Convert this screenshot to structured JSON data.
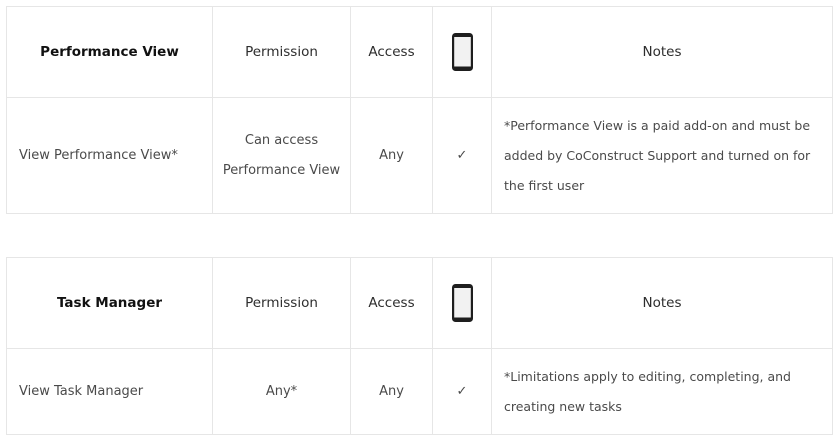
{
  "tables": [
    {
      "header": {
        "feature": "Performance View",
        "permission": "Permission",
        "access": "Access",
        "mobile_icon": "smartphone-icon",
        "notes": "Notes"
      },
      "row": {
        "feature": "View Performance View*",
        "permission_lines": [
          "Can access",
          "Performance View"
        ],
        "access": "Any",
        "mobile": "✓",
        "notes_lines": [
          "*Performance View is a paid add-on and must be",
          "added by CoConstruct Support and turned on for",
          "the first user"
        ]
      }
    },
    {
      "header": {
        "feature": "Task Manager",
        "permission": "Permission",
        "access": "Access",
        "mobile_icon": "smartphone-icon",
        "notes": "Notes"
      },
      "row": {
        "feature": "View Task Manager",
        "permission": "Any*",
        "access": "Any",
        "mobile": "✓",
        "notes_lines": [
          "*Limitations apply to editing, completing, and",
          "creating new tasks"
        ]
      }
    }
  ]
}
